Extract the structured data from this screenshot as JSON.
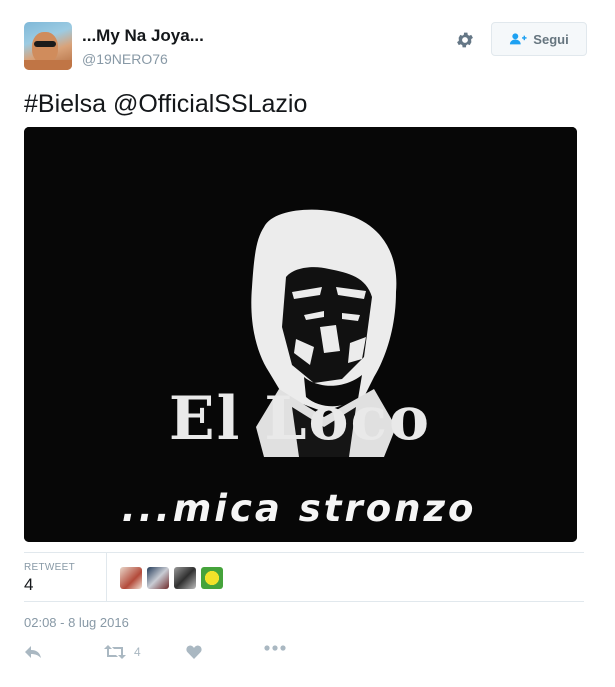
{
  "author": {
    "name": "...My Na Joya...",
    "handle": "@19NERO76"
  },
  "follow_button": {
    "label": "Segui",
    "icon": "follow-user-icon"
  },
  "tweet": {
    "text": "#Bielsa @OfficialSSLazio",
    "image": {
      "title": "El Loco",
      "subtitle": "...mica stronzo"
    }
  },
  "stats": {
    "retweet_label": "RETWEET",
    "retweet_count": "4",
    "retweeters_count": 4
  },
  "timestamp": "02:08 - 8 lug 2016",
  "actions": {
    "retweet_count": "4",
    "icons": [
      "reply-icon",
      "retweet-icon",
      "like-icon",
      "more-icon"
    ]
  },
  "colors": {
    "text": "#14171a",
    "muted": "#8899a6",
    "action": "#aab8c2",
    "border": "#e1e8ed"
  }
}
